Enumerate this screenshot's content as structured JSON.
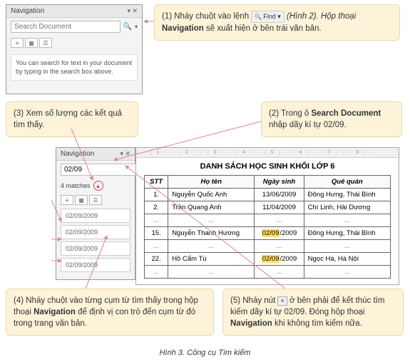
{
  "nav1": {
    "title": "Navigation",
    "placeholder": "Search Document",
    "hint": "You can search for text in your document by typing in the search box above."
  },
  "nav2": {
    "title": "Navigation",
    "search_value": "02/09",
    "matches": "4 matches",
    "results": [
      "02/09/2009",
      "02/09/2009",
      "02/09/2009",
      "02/09/2009"
    ]
  },
  "callouts": {
    "c1a": "(1) Nháy chuột vào lệnh ",
    "c1_find": "Find",
    "c1b": " (Hình 2). Hộp thoại ",
    "c1_nav": "Navigation",
    "c1c": " sẽ xuất hiện ở bên trái văn bản.",
    "c2a": "(2) Trong ô ",
    "c2_sd": "Search Document",
    "c2b": " nhập dãy kí tự 02/09.",
    "c3": "(3) Xem số lượng các kết quả tìm thấy.",
    "c4a": "(4) Nháy chuột vào từng cụm từ tìm thấy trong hộp thoại ",
    "c4_nav": "Navigation",
    "c4b": " để định vị con trỏ đến cụm từ đó trong trang văn bản.",
    "c5a": "(5) Nháy nút ",
    "c5b": " ở bên phải để kết thúc tìm kiếm dãy kí tự 02/09. Đóng hộp thoại ",
    "c5_nav": "Navigation",
    "c5c": " khi không tìm kiếm nữa."
  },
  "doc": {
    "title": "DANH SÁCH HỌC SINH KHỐI LỚP 6",
    "headers": [
      "STT",
      "Họ tên",
      "Ngày sinh",
      "Quê quán"
    ],
    "rows": [
      {
        "stt": "1.",
        "name": "Nguyễn Quốc Anh",
        "dob_pre": "",
        "dob": "13/06/2009",
        "place": "Đông Hưng, Thái Bình",
        "hl": false
      },
      {
        "stt": "2.",
        "name": "Trần Quang Anh",
        "dob_pre": "",
        "dob": "11/04/2009",
        "place": "Chí Linh, Hải Dương",
        "hl": false
      },
      {
        "stt": "...",
        "name": "...",
        "dob_pre": "",
        "dob": "...",
        "place": "...",
        "ell": true
      },
      {
        "stt": "15.",
        "name": "Nguyễn Thanh Hương",
        "dob_pre": "02/09",
        "dob": "/2009",
        "place": "Đông Hưng, Thái Bình",
        "hl": true
      },
      {
        "stt": "...",
        "name": "...",
        "dob_pre": "",
        "dob": "...",
        "place": "...",
        "ell": true
      },
      {
        "stt": "22.",
        "name": "Hồ Cẩm Tú",
        "dob_pre": "02/09",
        "dob": "/2009",
        "place": "Ngọc Hà, Hà Nội",
        "hl": true
      },
      {
        "stt": "...",
        "name": "...",
        "dob_pre": "",
        "dob": "...",
        "place": "...",
        "ell": true
      }
    ]
  },
  "caption": "Hình 3. Công cụ Tìm kiếm",
  "close_x": "×",
  "dropdown": "▾",
  "mag": "🔍"
}
